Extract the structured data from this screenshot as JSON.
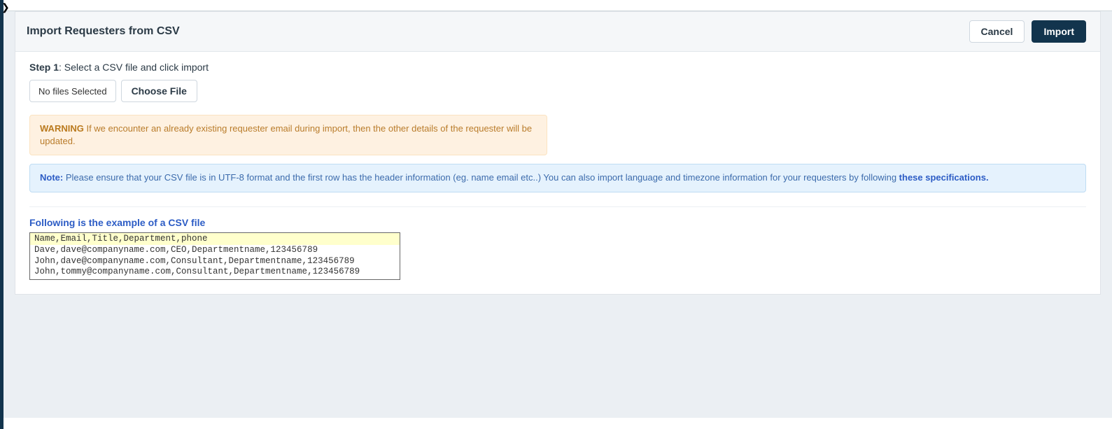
{
  "header": {
    "title": "Import Requesters from CSV",
    "cancel_label": "Cancel",
    "import_label": "Import"
  },
  "step": {
    "label_bold": "Step 1",
    "label_rest": ": Select a CSV file and click import"
  },
  "file": {
    "status": "No files Selected",
    "choose_label": "Choose File"
  },
  "warning": {
    "prefix": "WARNING",
    "text": " If we encounter an already existing requester email during import, then the other details of the requester will be updated."
  },
  "note": {
    "prefix": "Note:",
    "text": " Please ensure that your CSV file is in UTF-8 format and the first row has the header information (eg. name email etc..) You can also import language and timezone information for your requesters by following ",
    "link": "these specifications."
  },
  "example": {
    "heading": "Following is the example of a CSV file",
    "csv_header": "Name,Email,Title,Department,phone",
    "rows": [
      "Dave,dave@companyname.com,CEO,Departmentname,123456789",
      "John,dave@companyname.com,Consultant,Departmentname,123456789",
      "John,tommy@companyname.com,Consultant,Departmentname,123456789"
    ]
  }
}
